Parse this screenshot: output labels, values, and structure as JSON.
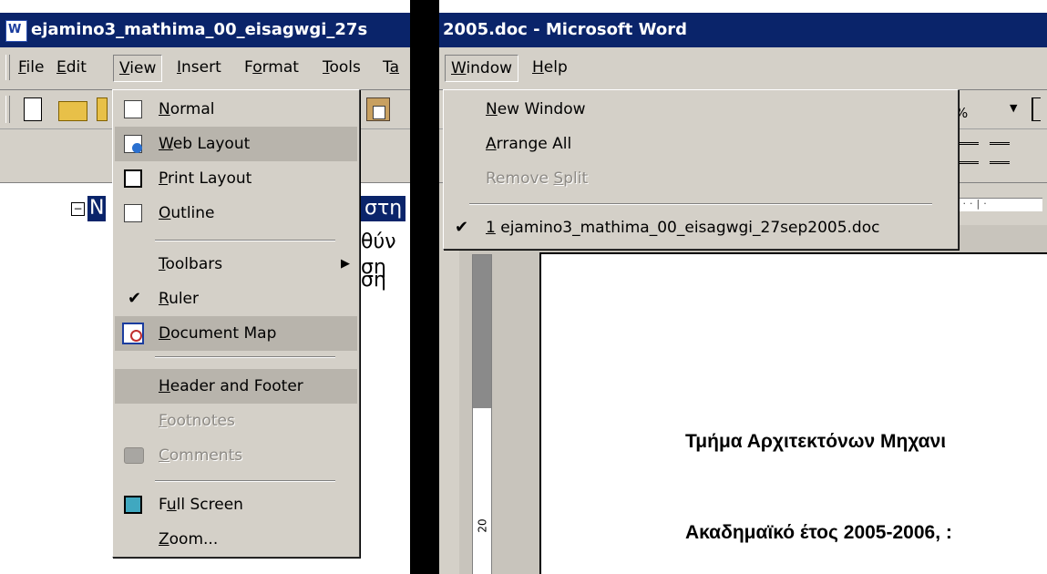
{
  "left_window": {
    "title": "ejamino3_mathima_00_eisagwgi_27s",
    "menus": [
      {
        "label": "File",
        "key": "F",
        "rest": "ile"
      },
      {
        "label": "Edit",
        "key": "E",
        "rest": "dit"
      },
      {
        "label": "View",
        "key": "V",
        "rest": "iew"
      },
      {
        "label": "Insert",
        "key": "I",
        "rest": "nsert"
      },
      {
        "label": "Format",
        "pre": "F",
        "key": "o",
        "rest": "rmat"
      },
      {
        "label": "Tools",
        "key": "T",
        "rest": "ools"
      },
      {
        "label": "Ta",
        "pre": "T",
        "key": "a",
        "rest": ""
      }
    ],
    "docmap": {
      "heading": "Ν",
      "right1": "στη",
      "right2": "θύν",
      "right3": "ση",
      "right4": "ση"
    },
    "view_menu": {
      "items": [
        {
          "pre": "",
          "key": "N",
          "rest": "ormal"
        },
        {
          "pre": "",
          "key": "W",
          "rest": "eb Layout"
        },
        {
          "pre": "",
          "key": "P",
          "rest": "rint Layout"
        },
        {
          "pre": "",
          "key": "O",
          "rest": "utline"
        },
        {
          "pre": "",
          "key": "T",
          "rest": "oolbars"
        },
        {
          "pre": "",
          "key": "R",
          "rest": "uler"
        },
        {
          "pre": "",
          "key": "D",
          "rest": "ocument Map"
        },
        {
          "pre": "",
          "key": "H",
          "rest": "eader and Footer"
        },
        {
          "pre": "",
          "key": "F",
          "rest": "ootnotes"
        },
        {
          "pre": "",
          "key": "C",
          "rest": "omments"
        },
        {
          "pre": "F",
          "key": "u",
          "rest": "ll Screen"
        },
        {
          "pre": "",
          "key": "Z",
          "rest": "oom..."
        }
      ]
    }
  },
  "right_window": {
    "title": "2005.doc - Microsoft Word",
    "menus": [
      {
        "label": "Window",
        "key": "W",
        "rest": "indow"
      },
      {
        "label": "Help",
        "key": "H",
        "rest": "elp"
      }
    ],
    "zoom_fragment": "%",
    "window_menu": {
      "items": [
        {
          "pre": "",
          "key": "N",
          "rest": "ew Window"
        },
        {
          "pre": "",
          "key": "A",
          "rest": "rrange All"
        },
        {
          "pre": "Remove ",
          "key": "S",
          "rest": "plit"
        },
        {
          "pre": "",
          "key": "1",
          "rest": " ejamino3_mathima_00_eisagwgi_27sep2005.doc"
        }
      ]
    },
    "vruler_number": "20",
    "document": {
      "line1": "Τμήμα Αρχιτεκτόνων Μηχανι",
      "line2": "Ακαδημαϊκό έτος 2005-2006, :"
    }
  }
}
